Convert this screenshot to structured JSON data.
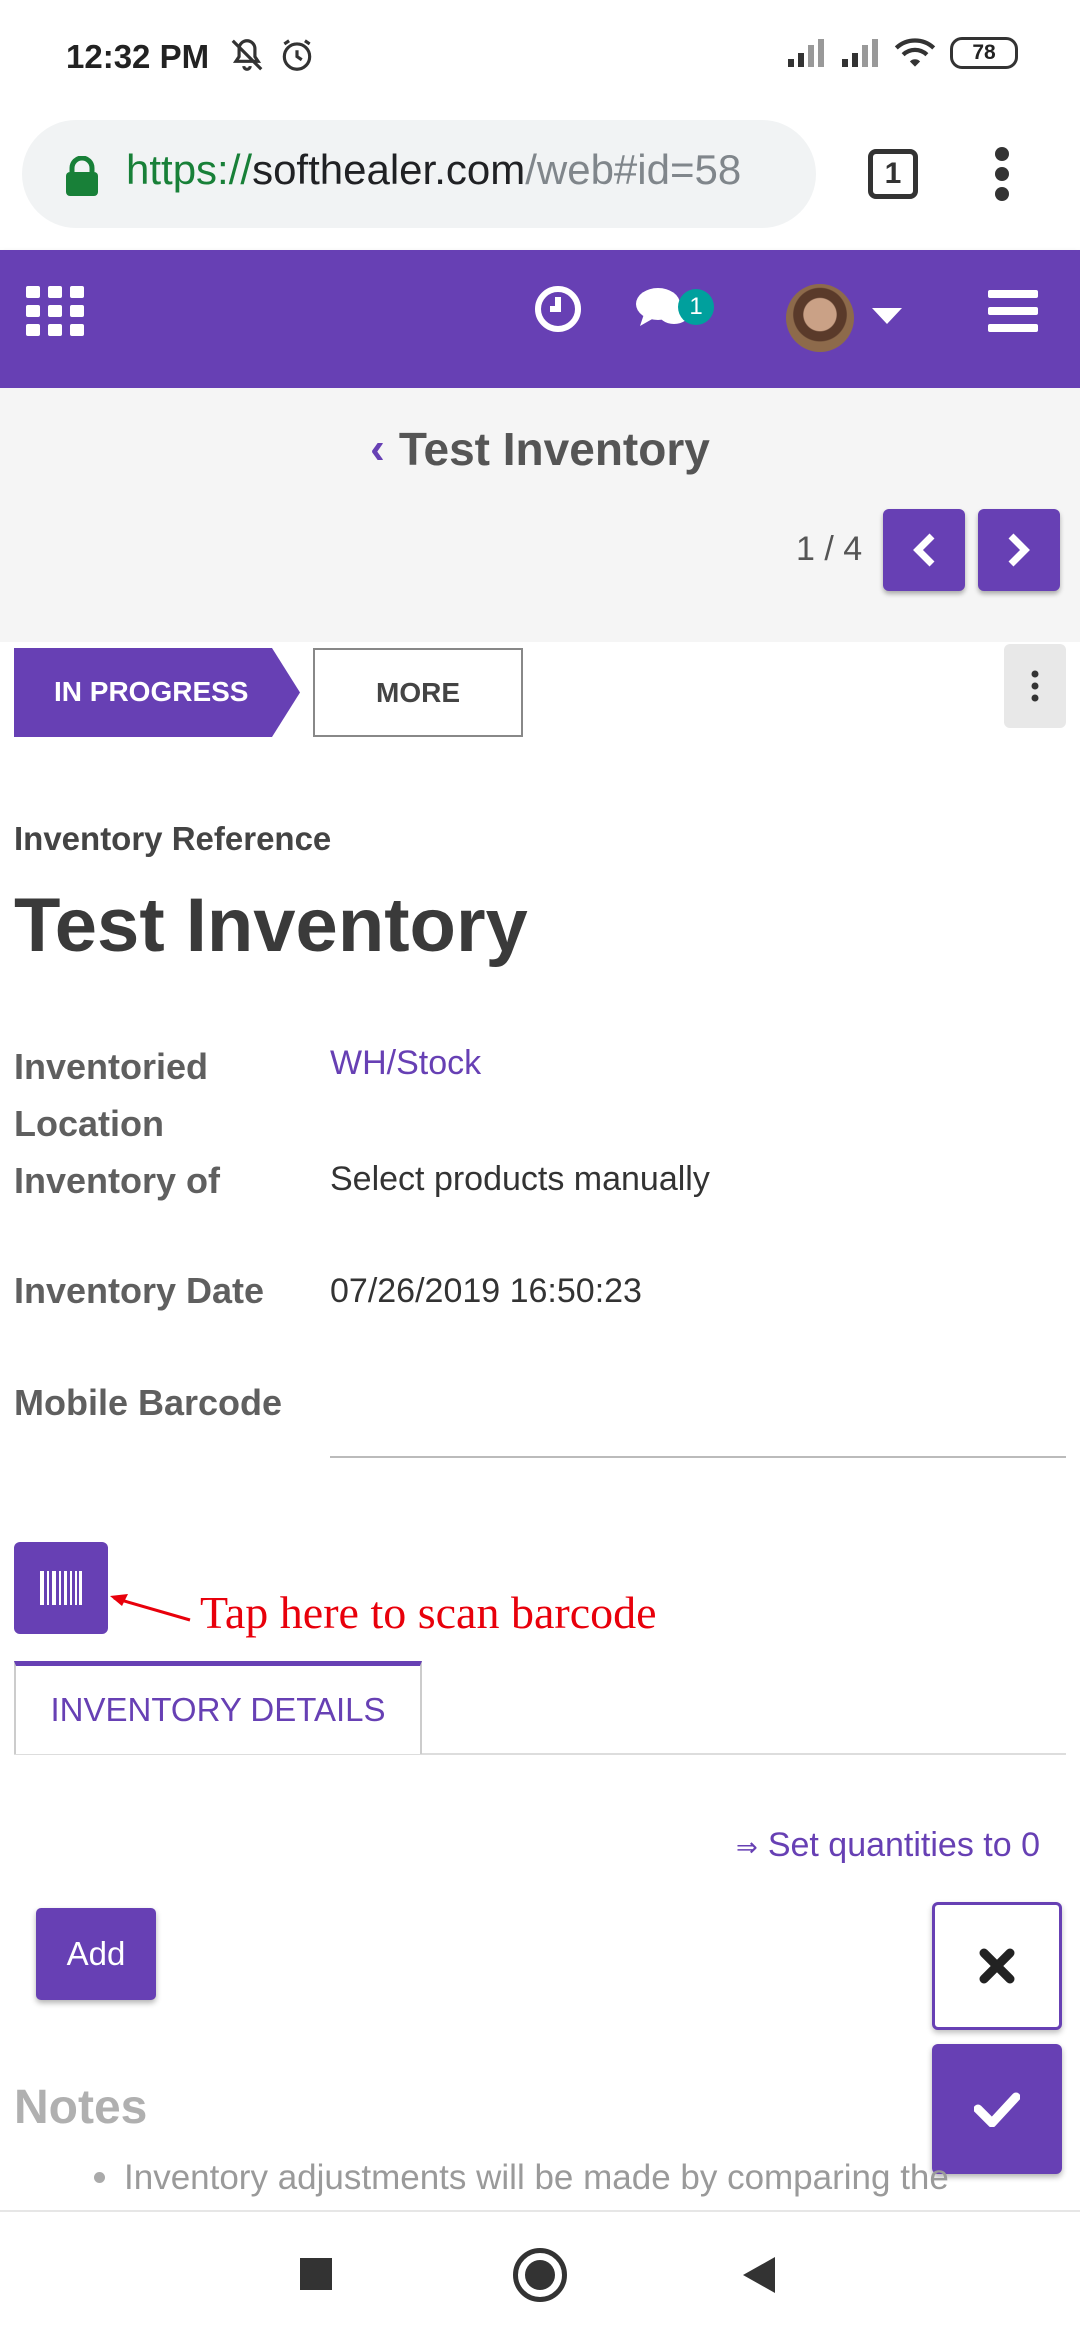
{
  "status_bar": {
    "time": "12:32 PM",
    "battery": "78",
    "icons_left": [
      "mute-icon",
      "alarm-icon"
    ],
    "icons_right": [
      "signal-icon",
      "signal-icon",
      "wifi-icon",
      "battery-icon"
    ]
  },
  "browser": {
    "url_scheme": "https://",
    "url_host": "softhealer.com",
    "url_path": "/web#id=58",
    "tab_count": "1"
  },
  "app_bar": {
    "chat_badge": "1",
    "icons": [
      "apps-grid-icon",
      "clock-icon",
      "chat-icon",
      "avatar",
      "caret-down-icon",
      "hamburger-icon"
    ]
  },
  "control_panel": {
    "breadcrumb_back": "‹",
    "title": "Test Inventory",
    "pager": "1 / 4"
  },
  "form": {
    "stage_active": "IN PROGRESS",
    "more_label": "MORE",
    "reference_label": "Inventory Reference",
    "reference_value": "Test Inventory",
    "location_label": "Inventoried Location",
    "location_value": "WH/Stock",
    "inventory_of_label": "Inventory of",
    "inventory_of_value": "Select products manually",
    "date_label": "Inventory Date",
    "date_value": "07/26/2019 16:50:23",
    "barcode_label": "Mobile Barcode",
    "barcode_value": "",
    "scan_annotation": "Tap here to scan barcode",
    "tab_label": "INVENTORY DETAILS",
    "set_qty_arrow": "⇒",
    "set_qty_label": "Set quantities to 0",
    "add_label": "Add",
    "notes_title": "Notes",
    "notes_item": "Inventory adjustments will be made by comparing the"
  },
  "colors": {
    "brand": "#6740b4",
    "annotation": "#e8000b",
    "secure": "#188038",
    "badge": "#00a09d"
  }
}
